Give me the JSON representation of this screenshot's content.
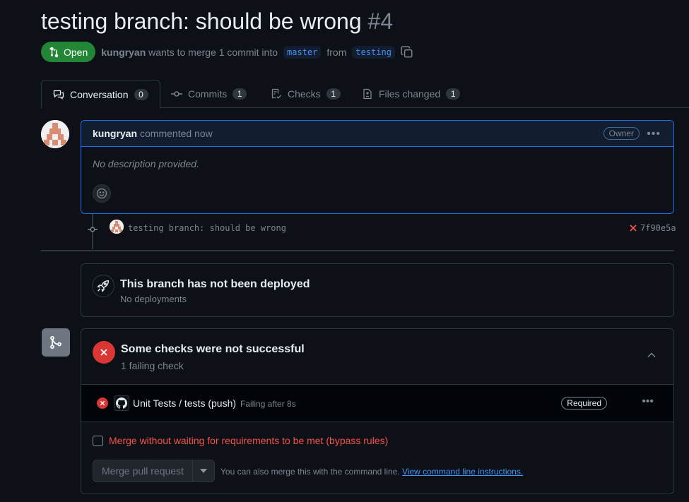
{
  "header": {
    "title": "testing branch: should be wrong",
    "number": "#4",
    "state": "Open",
    "author": "kungryan",
    "merge_text": "wants to merge 1 commit into",
    "base_branch": "master",
    "from_text": "from",
    "head_branch": "testing"
  },
  "tabs": [
    {
      "label": "Conversation",
      "count": "0"
    },
    {
      "label": "Commits",
      "count": "1"
    },
    {
      "label": "Checks",
      "count": "1"
    },
    {
      "label": "Files changed",
      "count": "1"
    }
  ],
  "comment": {
    "author": "kungryan",
    "time": "commented now",
    "role": "Owner",
    "body": "No description provided."
  },
  "commit": {
    "message": "testing branch: should be wrong",
    "sha": "7f90e5a",
    "status": "failed"
  },
  "deployment": {
    "title": "This branch has not been deployed",
    "subtitle": "No deployments"
  },
  "checks": {
    "title": "Some checks were not successful",
    "subtitle": "1 failing check",
    "items": [
      {
        "name": "Unit Tests / tests (push)",
        "time": "Failing after 8s",
        "badge": "Required"
      }
    ],
    "bypass_label": "Merge without waiting for requirements to be met (bypass rules)",
    "merge_button": "Merge pull request",
    "cli_text": "You can also merge this with the command line.",
    "cli_link": "View command line instructions."
  },
  "colors": {
    "background": "#0d1117",
    "open_green": "#238636",
    "danger_red": "#da3633",
    "link_blue": "#4493f8"
  }
}
